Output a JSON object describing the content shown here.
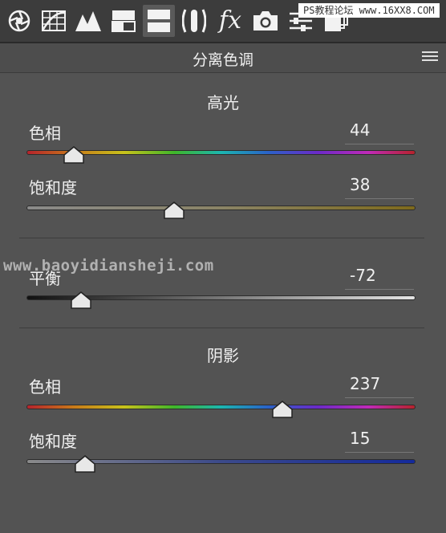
{
  "toolbar": {
    "tools": [
      {
        "icon": "aperture-icon"
      },
      {
        "icon": "tone-curve-grid-icon"
      },
      {
        "icon": "mountains-detail-icon"
      },
      {
        "icon": "hsl-grayscale-icon"
      },
      {
        "icon": "split-toning-icon",
        "active": true
      },
      {
        "icon": "lens-corrections-icon"
      },
      {
        "icon": "fx-effects-icon",
        "text": "fx"
      },
      {
        "icon": "camera-calibration-icon"
      },
      {
        "icon": "presets-sliders-icon"
      },
      {
        "icon": "snapshots-icon"
      }
    ],
    "watermark": "PS教程论坛 www.16XX8.COM"
  },
  "panel": {
    "title": "分离色调",
    "menu_icon": "panel-menu-icon"
  },
  "highlights": {
    "title": "高光",
    "hue": {
      "label": "色相",
      "value": "44",
      "min": 0,
      "max": 360
    },
    "saturation": {
      "label": "饱和度",
      "value": "38",
      "min": 0,
      "max": 100
    }
  },
  "balance": {
    "label": "平衡",
    "value": "-72",
    "min": -100,
    "max": 100
  },
  "shadows": {
    "title": "阴影",
    "hue": {
      "label": "色相",
      "value": "237",
      "min": 0,
      "max": 360
    },
    "saturation": {
      "label": "饱和度",
      "value": "15",
      "min": 0,
      "max": 100
    }
  },
  "watermark_mid": "www.baoyidiansheji.com"
}
